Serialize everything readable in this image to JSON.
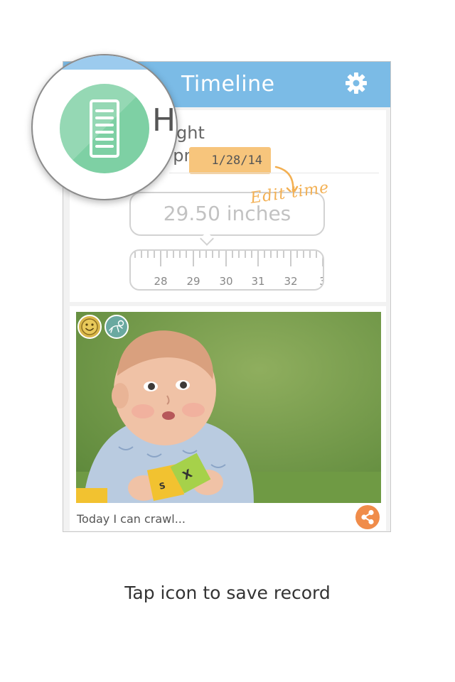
{
  "header": {
    "title": "Timeline",
    "settings_icon": "gear-icon"
  },
  "record": {
    "type_label_partial": "ght",
    "time_partial": "7pm",
    "date": "1/28/14",
    "value": "29.50 inches",
    "edit_hint": "Edit time",
    "ruler_ticks": [
      "28",
      "29",
      "30",
      "31",
      "32",
      "3"
    ]
  },
  "magnifier": {
    "partial_letter": "H",
    "icon": "ruler-icon",
    "icon_color": "#7ed0a4"
  },
  "photo": {
    "badges": [
      {
        "name": "smiley-badge-icon",
        "color": "#d9b74a"
      },
      {
        "name": "crawling-baby-badge-icon",
        "color": "#6aa9a0"
      }
    ],
    "caption": "Today I can crawl...",
    "share_icon": "share-icon",
    "share_color": "#f08c4a"
  },
  "colors": {
    "header": "#7bbbe6",
    "date_pill": "#f7c57c",
    "edit_hint": "#f3b053"
  },
  "tagline": "Tap icon to save record"
}
